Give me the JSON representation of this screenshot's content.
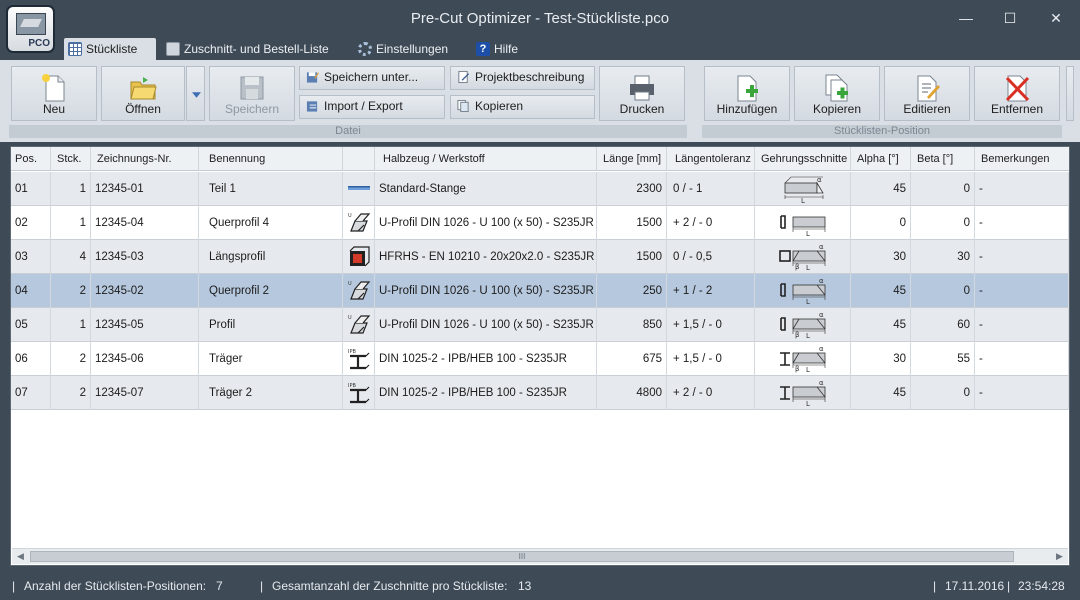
{
  "app": {
    "title": "Pre-Cut Optimizer - Test-Stückliste.pco",
    "logo_text": "PCO"
  },
  "window_controls": {
    "minimize": "—",
    "maximize": "☐",
    "close": "✕"
  },
  "menu": [
    {
      "label": "Stückliste",
      "icon": "table-icon"
    },
    {
      "label": "Zuschnitt- und Bestell-Liste",
      "icon": "cut-icon"
    },
    {
      "label": "Einstellungen",
      "icon": "gear-icon"
    },
    {
      "label": "Hilfe",
      "icon": "help-icon"
    }
  ],
  "ribbon": {
    "datei": {
      "group_label": "Datei",
      "neu": "Neu",
      "oeffnen": "Öffnen",
      "speichern": "Speichern",
      "speichern_unter": "Speichern unter...",
      "import_export": "Import / Export",
      "projektbeschreibung": "Projektbeschreibung",
      "kopieren": "Kopieren",
      "drucken": "Drucken"
    },
    "position": {
      "group_label": "Stücklisten-Position",
      "hinzufuegen": "Hinzufügen",
      "kopieren": "Kopieren",
      "editieren": "Editieren",
      "entfernen": "Entfernen"
    }
  },
  "table": {
    "headers": {
      "pos": "Pos.",
      "stck": "Stck.",
      "znr": "Zeichnungs-Nr.",
      "benennung": "Benennung",
      "halbzeug": "Halbzeug / Werkstoff",
      "laenge": "Länge [mm]",
      "toleranz": "Längentoleranz",
      "gehrung": "Gehrungsschnitte",
      "alpha": "Alpha [°]",
      "beta": "Beta [°]",
      "bemerkungen": "Bemerkungen"
    },
    "rows": [
      {
        "pos": "01",
        "stck": "1",
        "znr": "12345-01",
        "benennung": "Teil 1",
        "profile": "bar",
        "halbzeug": "Standard-Stange",
        "laenge": "2300",
        "toleranz": "0 / - 1",
        "mitre": "alpha",
        "alpha": "45",
        "beta": "0",
        "bemerkungen": "-"
      },
      {
        "pos": "02",
        "stck": "1",
        "znr": "12345-04",
        "benennung": "Querprofil 4",
        "profile": "u",
        "halbzeug": "U-Profil DIN 1026 - U 100 (x 50) - S235JR",
        "laenge": "1500",
        "toleranz": "+ 2 / - 0",
        "mitre": "u-straight",
        "alpha": "0",
        "beta": "0",
        "bemerkungen": "-"
      },
      {
        "pos": "03",
        "stck": "4",
        "znr": "12345-03",
        "benennung": "Längsprofil",
        "profile": "rhs",
        "halbzeug": "HFRHS - EN 10210 - 20x20x2.0 - S235JR",
        "laenge": "1500",
        "toleranz": "0 / - 0,5",
        "mitre": "rhs-ab",
        "alpha": "30",
        "beta": "30",
        "bemerkungen": "-"
      },
      {
        "pos": "04",
        "stck": "2",
        "znr": "12345-02",
        "benennung": "Querprofil 2",
        "profile": "u",
        "halbzeug": "U-Profil DIN 1026 - U 100 (x 50) - S235JR",
        "laenge": "250",
        "toleranz": "+ 1 / - 2",
        "mitre": "u-alpha",
        "alpha": "45",
        "beta": "0",
        "bemerkungen": "-"
      },
      {
        "pos": "05",
        "stck": "1",
        "znr": "12345-05",
        "benennung": "Profil",
        "profile": "u",
        "halbzeug": "U-Profil DIN 1026 - U 100 (x 50) - S235JR",
        "laenge": "850",
        "toleranz": "+ 1,5 / - 0",
        "mitre": "u-ab",
        "alpha": "45",
        "beta": "60",
        "bemerkungen": "-"
      },
      {
        "pos": "06",
        "stck": "2",
        "znr": "12345-06",
        "benennung": "Träger",
        "profile": "ipb",
        "halbzeug": "DIN 1025-2 - IPB/HEB 100 - S235JR",
        "laenge": "675",
        "toleranz": "+ 1,5 / - 0",
        "mitre": "i-ab",
        "alpha": "30",
        "beta": "55",
        "bemerkungen": "-"
      },
      {
        "pos": "07",
        "stck": "2",
        "znr": "12345-07",
        "benennung": "Träger 2",
        "profile": "ipb",
        "halbzeug": "DIN 1025-2 - IPB/HEB 100 - S235JR",
        "laenge": "4800",
        "toleranz": "+ 2 / - 0",
        "mitre": "i-alpha",
        "alpha": "45",
        "beta": "0",
        "bemerkungen": "-"
      }
    ],
    "selected_row": 3
  },
  "scrollbar": {
    "grip": "III"
  },
  "status": {
    "positions_label": "Anzahl der Stücklisten-Positionen:",
    "positions_value": "7",
    "cuts_label": "Gesamtanzahl der Zuschnitte pro Stückliste:",
    "cuts_value": "13",
    "date": "17.11.2016",
    "time": "23:54:28",
    "separator": "|"
  },
  "colors": {
    "chrome": "#3e4a56",
    "ribbon": "#d9dfe5",
    "selected_row": "#b6c8dd",
    "alt_row": "#e6e9ed"
  }
}
